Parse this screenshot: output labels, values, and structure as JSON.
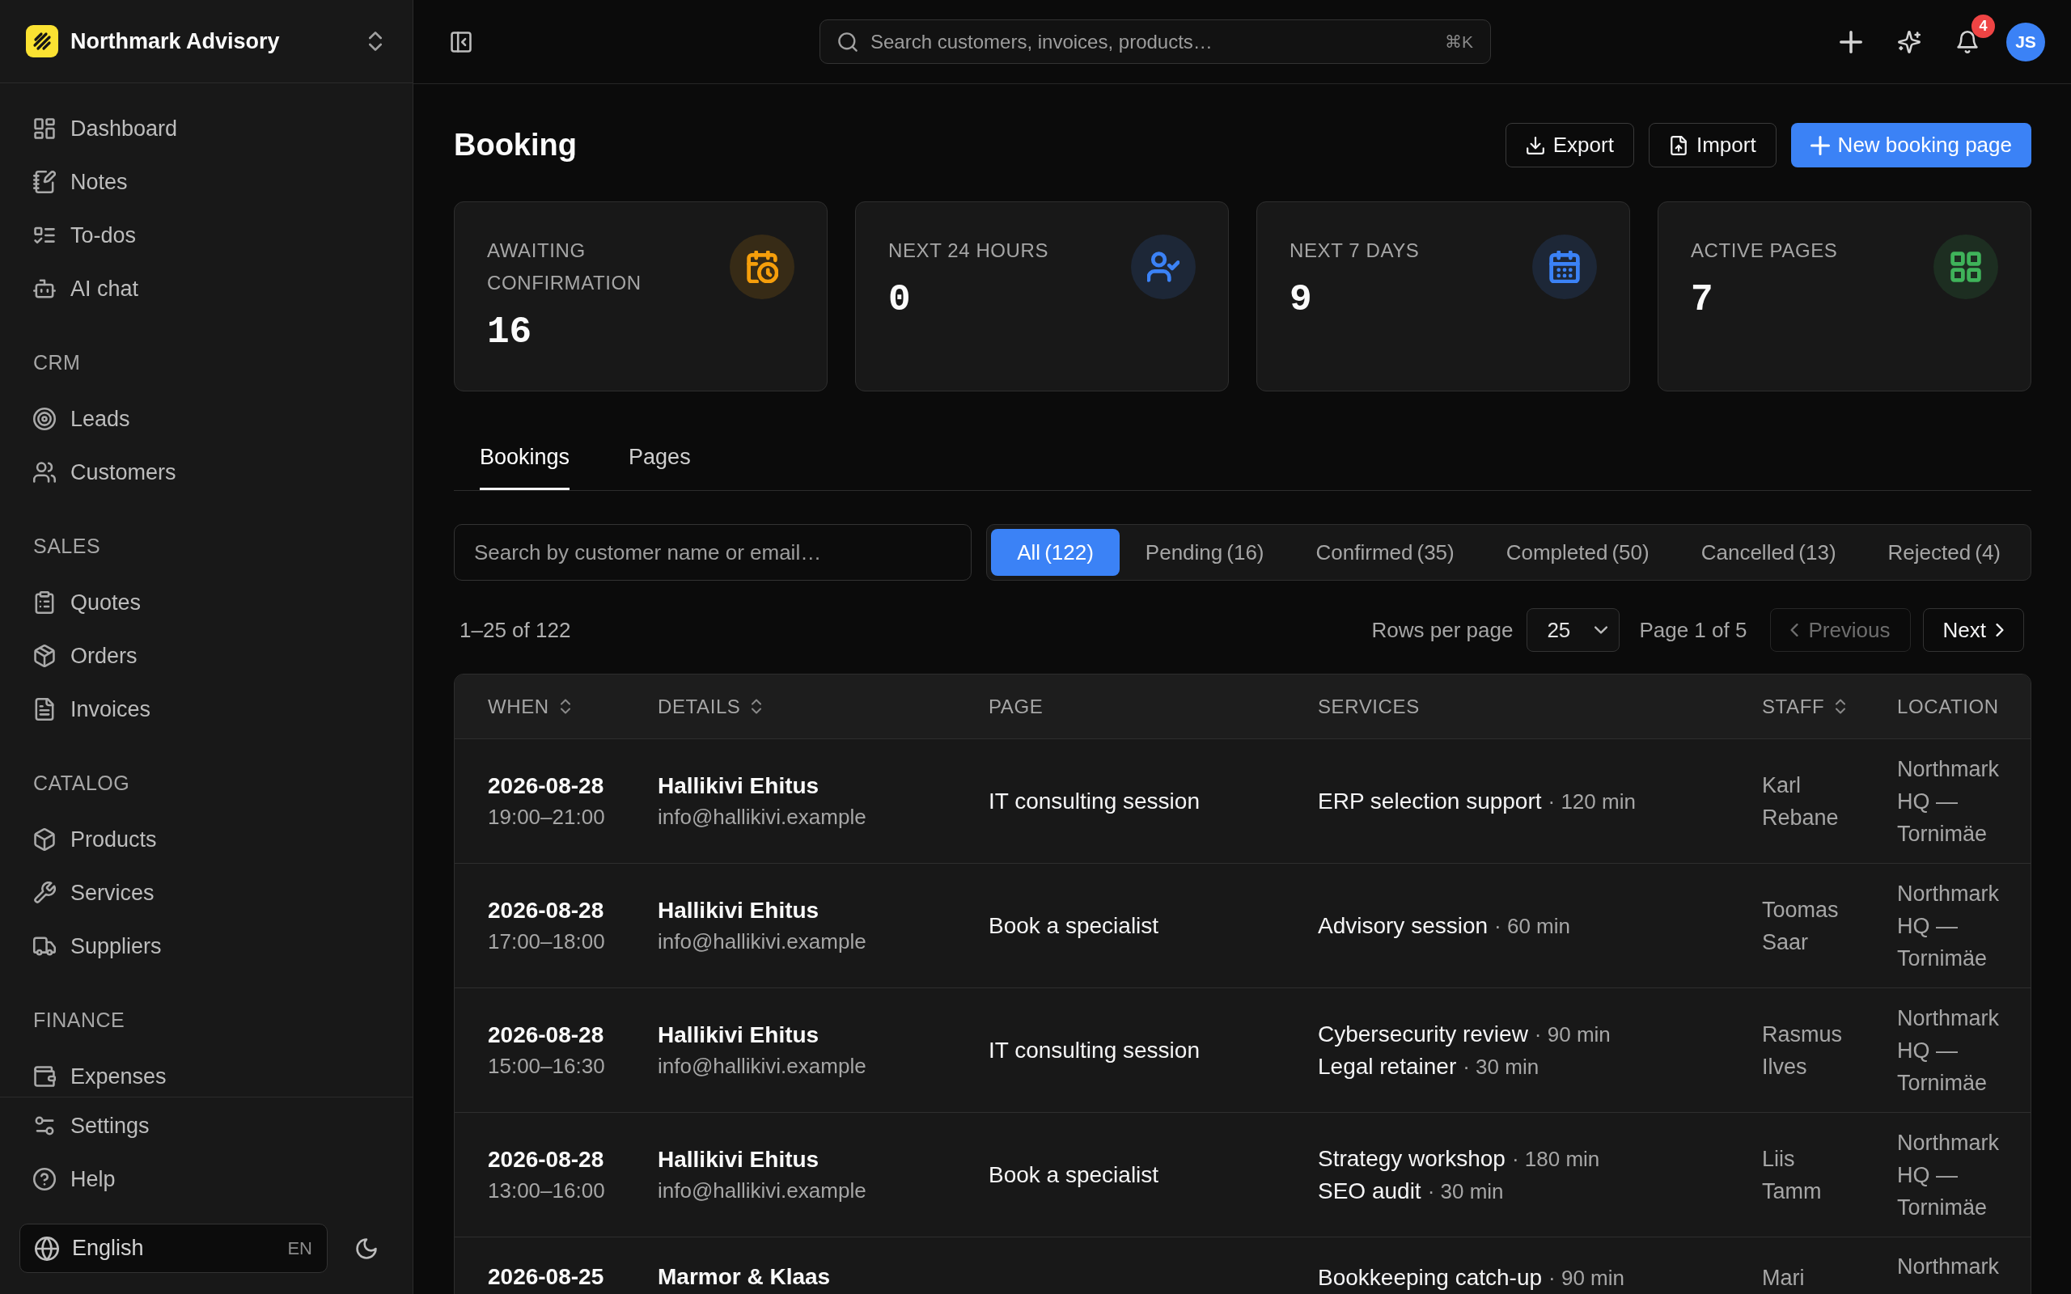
{
  "sidebar": {
    "workspace": {
      "name": "Northmark Advisory"
    },
    "sections": [
      {
        "items": [
          {
            "label": "Dashboard"
          },
          {
            "label": "Notes"
          },
          {
            "label": "To-dos"
          },
          {
            "label": "AI chat"
          }
        ]
      },
      {
        "title": "CRM",
        "items": [
          {
            "label": "Leads"
          },
          {
            "label": "Customers"
          }
        ]
      },
      {
        "title": "SALES",
        "items": [
          {
            "label": "Quotes"
          },
          {
            "label": "Orders"
          },
          {
            "label": "Invoices"
          }
        ]
      },
      {
        "title": "CATALOG",
        "items": [
          {
            "label": "Products"
          },
          {
            "label": "Services"
          },
          {
            "label": "Suppliers"
          }
        ]
      },
      {
        "title": "FINANCE",
        "items": [
          {
            "label": "Expenses"
          }
        ]
      }
    ],
    "footer_items": [
      {
        "label": "Settings"
      },
      {
        "label": "Help"
      }
    ],
    "language": {
      "label": "English",
      "code": "EN"
    }
  },
  "topbar": {
    "search": {
      "placeholder": "Search customers, invoices, products…",
      "shortcut": "⌘K"
    },
    "notifications": {
      "badge": "4"
    },
    "user": {
      "initials": "JS"
    }
  },
  "page": {
    "title": "Booking",
    "actions": [
      {
        "label": "Export",
        "kind": "export"
      },
      {
        "label": "Import",
        "kind": "import"
      },
      {
        "label": "New booking page",
        "kind": "create"
      }
    ]
  },
  "stats": [
    {
      "label": "AWAITING CONFIRMATION",
      "value": "16",
      "color": "#f59e0b"
    },
    {
      "label": "NEXT 24 HOURS",
      "value": "0",
      "color": "#3b82f6"
    },
    {
      "label": "NEXT 7 DAYS",
      "value": "9",
      "color": "#3b82f6"
    },
    {
      "label": "ACTIVE PAGES",
      "value": "7",
      "color": "#3fb35a"
    }
  ],
  "tabs": [
    {
      "label": "Bookings",
      "selected": true
    },
    {
      "label": "Pages",
      "selected": false
    }
  ],
  "filters": {
    "search": {
      "placeholder": "Search by customer name or email…"
    },
    "statuses": [
      {
        "label": "All",
        "count": "(122)",
        "selected": true
      },
      {
        "label": "Pending",
        "count": "(16)",
        "selected": false
      },
      {
        "label": "Confirmed",
        "count": "(35)",
        "selected": false
      },
      {
        "label": "Completed",
        "count": "(50)",
        "selected": false
      },
      {
        "label": "Cancelled",
        "count": "(13)",
        "selected": false
      },
      {
        "label": "Rejected",
        "count": "(4)",
        "selected": false
      }
    ]
  },
  "pagination": {
    "range": "1–25 of 122",
    "rows_per_page": {
      "label": "Rows per page",
      "value": "25"
    },
    "page": "Page 1 of 5",
    "previous": {
      "label": "Previous",
      "disabled": true
    },
    "next": {
      "label": "Next",
      "disabled": false
    }
  },
  "table": {
    "columns": [
      {
        "label": "WHEN",
        "sortable": true
      },
      {
        "label": "DETAILS",
        "sortable": true
      },
      {
        "label": "PAGE",
        "sortable": false
      },
      {
        "label": "SERVICES",
        "sortable": false
      },
      {
        "label": "STAFF",
        "sortable": true
      },
      {
        "label": "LOCATION",
        "sortable": false
      }
    ],
    "rows": [
      {
        "date": "2026-08-28",
        "time": "19:00–21:00",
        "customer": "Hallikivi Ehitus",
        "email": "info@hallikivi.example",
        "page": "IT consulting session",
        "services": [
          {
            "name": "ERP selection support",
            "duration": "· 120 min"
          }
        ],
        "staff": "Karl Rebane",
        "location": "Northmark HQ — Tornimäe"
      },
      {
        "date": "2026-08-28",
        "time": "17:00–18:00",
        "customer": "Hallikivi Ehitus",
        "email": "info@hallikivi.example",
        "page": "Book a specialist",
        "services": [
          {
            "name": "Advisory session",
            "duration": "· 60 min"
          }
        ],
        "staff": "Toomas Saar",
        "location": "Northmark HQ — Tornimäe"
      },
      {
        "date": "2026-08-28",
        "time": "15:00–16:30",
        "customer": "Hallikivi Ehitus",
        "email": "info@hallikivi.example",
        "page": "IT consulting session",
        "services": [
          {
            "name": "Cybersecurity review",
            "duration": "· 90 min"
          },
          {
            "name": "Legal retainer",
            "duration": "· 30 min"
          }
        ],
        "staff": "Rasmus Ilves",
        "location": "Northmark HQ — Tornimäe"
      },
      {
        "date": "2026-08-28",
        "time": "13:00–16:00",
        "customer": "Hallikivi Ehitus",
        "email": "info@hallikivi.example",
        "page": "Book a specialist",
        "services": [
          {
            "name": "Strategy workshop",
            "duration": "· 180 min"
          },
          {
            "name": "SEO audit",
            "duration": "· 30 min"
          }
        ],
        "staff": "Liis Tamm",
        "location": "Northmark HQ — Tornimäe"
      },
      {
        "date": "2026-08-25",
        "customer": "Marmor & Klaas",
        "services": [
          {
            "name": "Bookkeeping catch-up",
            "duration": "· 90 min"
          }
        ],
        "staff": "Mari",
        "location": "Northmark"
      }
    ]
  }
}
